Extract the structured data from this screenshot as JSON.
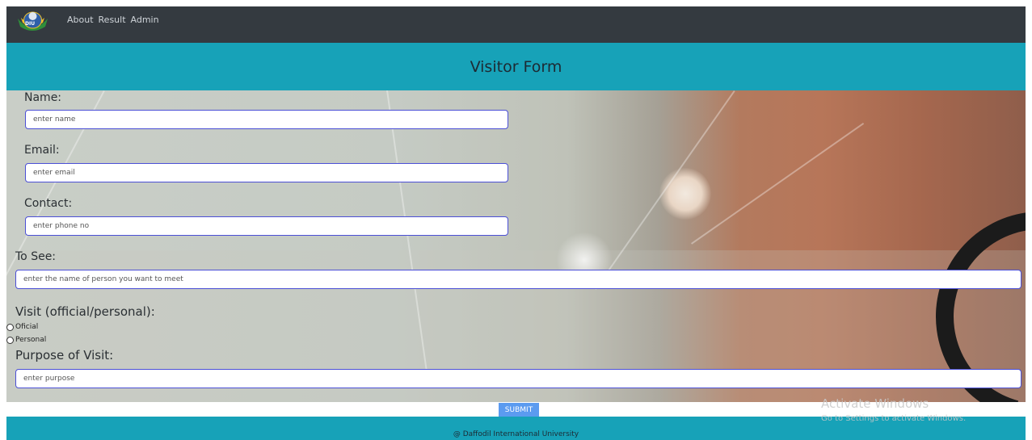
{
  "navbar": {
    "logo_text": "DIU",
    "links": [
      "About",
      "Result",
      "Admin"
    ]
  },
  "header": {
    "title": "Visitor Form"
  },
  "form": {
    "name": {
      "label": "Name:",
      "placeholder": "enter name"
    },
    "email": {
      "label": "Email:",
      "placeholder": "enter email"
    },
    "contact": {
      "label": "Contact:",
      "placeholder": "enter phone no"
    },
    "to_see": {
      "label": "To See:",
      "placeholder": "enter the name of person you want to meet"
    },
    "visit_type": {
      "label": "Visit (official/personal):",
      "options": [
        "Oficial",
        "Personal"
      ]
    },
    "purpose": {
      "label": "Purpose of Visit:",
      "placeholder": "enter purpose"
    },
    "submit_label": "SUBMIT"
  },
  "footer": {
    "text": "@ Daffodil International University"
  },
  "watermark": {
    "title": "Activate Windows",
    "subtitle": "Go to Settings to activate Windows."
  },
  "colors": {
    "navbar": "#343a40",
    "header": "#17a2b8",
    "input_border": "#4b4fd6",
    "submit": "#5b9bf0"
  }
}
